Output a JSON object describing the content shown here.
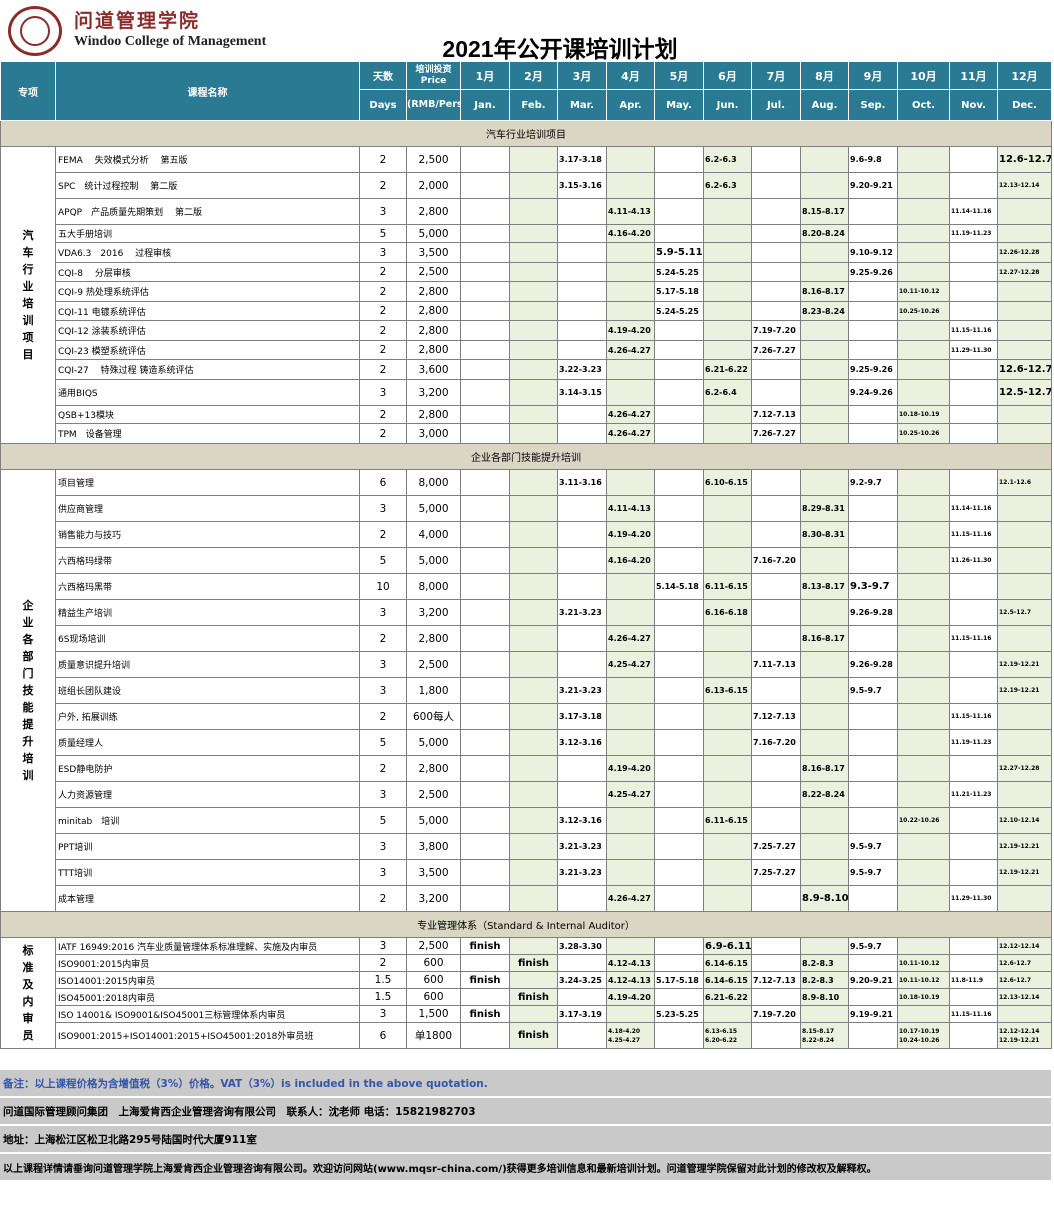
{
  "header": {
    "logo_cn": "问道管理学院",
    "logo_en": "Windoo College of Management",
    "title": "2021年公开课培训计划"
  },
  "columns": {
    "category": "专项",
    "name": "课程名称",
    "days_cn": "天数",
    "days_en": "Days",
    "price_cn": "培训投资",
    "price_en": "Price",
    "price_unit": "(RMB/Person)",
    "months_cn": [
      "1月",
      "2月",
      "3月",
      "4月",
      "5月",
      "6月",
      "7月",
      "8月",
      "9月",
      "10月",
      "11月",
      "12月"
    ],
    "months_en": [
      "Jan.",
      "Feb.",
      "Mar.",
      "Apr.",
      "May.",
      "Jun.",
      "Jul.",
      "Aug.",
      "Sep.",
      "Oct.",
      "Nov.",
      "Dec."
    ]
  },
  "sections": [
    {
      "title": "汽车行业培训项目",
      "category": "汽车行业培训项目",
      "rows": [
        {
          "name": "FEMA　 失效模式分析　 第五版",
          "days": "2",
          "price": "2,500",
          "m": [
            "",
            "",
            "3.17-3.18",
            "",
            "",
            "6.2-6.3",
            "",
            "",
            "9.6-9.8",
            "",
            "",
            "12.6-12.7"
          ]
        },
        {
          "name": "SPC　统计过程控制　 第二版",
          "days": "2",
          "price": "2,000",
          "m": [
            "",
            "",
            "3.15-3.16",
            "",
            "",
            "6.2-6.3",
            "",
            "",
            "9.20-9.21",
            "",
            "",
            "12.13-12.14"
          ]
        },
        {
          "name": "APQP　产品质量先期策划　 第二版",
          "days": "3",
          "price": "2,800",
          "m": [
            "",
            "",
            "",
            "4.11-4.13",
            "",
            "",
            "",
            "8.15-8.17",
            "",
            "",
            "11.14-11.16",
            ""
          ]
        },
        {
          "name": "五大手册培训",
          "days": "5",
          "price": "5,000",
          "m": [
            "",
            "",
            "",
            "4.16-4.20",
            "",
            "",
            "",
            "8.20-8.24",
            "",
            "",
            "11.19-11.23",
            ""
          ]
        },
        {
          "name": "VDA6.3　2016　 过程审核",
          "days": "3",
          "price": "3,500",
          "m": [
            "",
            "",
            "",
            "",
            "5.9-5.11",
            "",
            "",
            "",
            "9.10-9.12",
            "",
            "",
            "12.26-12.28"
          ]
        },
        {
          "name": "CQI-8　 分层审核",
          "days": "2",
          "price": "2,500",
          "m": [
            "",
            "",
            "",
            "",
            "5.24-5.25",
            "",
            "",
            "",
            "9.25-9.26",
            "",
            "",
            "12.27-12.28"
          ]
        },
        {
          "name": "CQI-9 热处理系统评估",
          "days": "2",
          "price": "2,800",
          "m": [
            "",
            "",
            "",
            "",
            "5.17-5.18",
            "",
            "",
            "8.16-8.17",
            "",
            "10.11-10.12",
            "",
            ""
          ]
        },
        {
          "name": "CQI-11 电镀系统评估",
          "days": "2",
          "price": "2,800",
          "m": [
            "",
            "",
            "",
            "",
            "5.24-5.25",
            "",
            "",
            "8.23-8.24",
            "",
            "10.25-10.26",
            "",
            ""
          ]
        },
        {
          "name": "CQI-12 涂装系统评估",
          "days": "2",
          "price": "2,800",
          "m": [
            "",
            "",
            "",
            "4.19-4.20",
            "",
            "",
            "7.19-7.20",
            "",
            "",
            "",
            "11.15-11.16",
            ""
          ]
        },
        {
          "name": "CQI-23 模塑系统评估",
          "days": "2",
          "price": "2,800",
          "m": [
            "",
            "",
            "",
            "4.26-4.27",
            "",
            "",
            "7.26-7.27",
            "",
            "",
            "",
            "11.29-11.30",
            ""
          ]
        },
        {
          "name": "CQI-27　 特殊过程 铸造系统评估",
          "days": "2",
          "price": "3,600",
          "m": [
            "",
            "",
            "3.22-3.23",
            "",
            "",
            "6.21-6.22",
            "",
            "",
            "9.25-9.26",
            "",
            "",
            "12.6-12.7"
          ]
        },
        {
          "name": "通用BIQS",
          "days": "3",
          "price": "3,200",
          "m": [
            "",
            "",
            "3.14-3.15",
            "",
            "",
            "6.2-6.4",
            "",
            "",
            "9.24-9.26",
            "",
            "",
            "12.5-12.7"
          ]
        },
        {
          "name": "QSB+13模块",
          "days": "2",
          "price": "2,800",
          "m": [
            "",
            "",
            "",
            "4.26-4.27",
            "",
            "",
            "7.12-7.13",
            "",
            "",
            "10.18-10.19",
            "",
            ""
          ]
        },
        {
          "name": "TPM　设备管理",
          "days": "2",
          "price": "3,000",
          "m": [
            "",
            "",
            "",
            "4.26-4.27",
            "",
            "",
            "7.26-7.27",
            "",
            "",
            "10.25-10.26",
            "",
            ""
          ]
        }
      ]
    },
    {
      "title": "企业各部门技能提升培训",
      "category": "企业各部门技能提升培训",
      "rows": [
        {
          "name": "项目管理",
          "days": "6",
          "price": "8,000",
          "m": [
            "",
            "",
            "3.11-3.16",
            "",
            "",
            "6.10-6.15",
            "",
            "",
            "9.2-9.7",
            "",
            "",
            "12.1-12.6"
          ]
        },
        {
          "name": "供应商管理",
          "days": "3",
          "price": "5,000",
          "m": [
            "",
            "",
            "",
            "4.11-4.13",
            "",
            "",
            "",
            "8.29-8.31",
            "",
            "",
            "11.14-11.16",
            ""
          ]
        },
        {
          "name": "销售能力与技巧",
          "days": "2",
          "price": "4,000",
          "m": [
            "",
            "",
            "",
            "4.19-4.20",
            "",
            "",
            "",
            "8.30-8.31",
            "",
            "",
            "11.15-11.16",
            ""
          ]
        },
        {
          "name": "六西格玛绿带",
          "days": "5",
          "price": "5,000",
          "m": [
            "",
            "",
            "",
            "4.16-4.20",
            "",
            "",
            "7.16-7.20",
            "",
            "",
            "",
            "11.26-11.30",
            ""
          ]
        },
        {
          "name": "六西格玛黑带",
          "days": "10",
          "price": "8,000",
          "m": [
            "",
            "",
            "",
            "",
            "5.14-5.18",
            "6.11-6.15",
            "",
            "8.13-8.17",
            "9.3-9.7",
            "",
            "",
            ""
          ]
        },
        {
          "name": "精益生产培训",
          "days": "3",
          "price": "3,200",
          "m": [
            "",
            "",
            "3.21-3.23",
            "",
            "",
            "6.16-6.18",
            "",
            "",
            "9.26-9.28",
            "",
            "",
            "12.5-12.7"
          ]
        },
        {
          "name": "6S现场培训",
          "days": "2",
          "price": "2,800",
          "m": [
            "",
            "",
            "",
            "4.26-4.27",
            "",
            "",
            "",
            "8.16-8.17",
            "",
            "",
            "11.15-11.16",
            ""
          ]
        },
        {
          "name": "质量意识提升培训",
          "days": "3",
          "price": "2,500",
          "m": [
            "",
            "",
            "",
            "4.25-4.27",
            "",
            "",
            "7.11-7.13",
            "",
            "9.26-9.28",
            "",
            "",
            "12.19-12.21"
          ]
        },
        {
          "name": "班组长团队建设",
          "days": "3",
          "price": "1,800",
          "m": [
            "",
            "",
            "3.21-3.23",
            "",
            "",
            "6.13-6.15",
            "",
            "",
            "9.5-9.7",
            "",
            "",
            "12.19-12.21"
          ]
        },
        {
          "name": "户外, 拓展训练",
          "days": "2",
          "price": "600每人",
          "m": [
            "",
            "",
            "3.17-3.18",
            "",
            "",
            "",
            "7.12-7.13",
            "",
            "",
            "",
            "11.15-11.16",
            ""
          ]
        },
        {
          "name": "质量经理人",
          "days": "5",
          "price": "5,000",
          "m": [
            "",
            "",
            "3.12-3.16",
            "",
            "",
            "",
            "7.16-7.20",
            "",
            "",
            "",
            "11.19-11.23",
            ""
          ]
        },
        {
          "name": "ESD静电防护",
          "days": "2",
          "price": "2,800",
          "m": [
            "",
            "",
            "",
            "4.19-4.20",
            "",
            "",
            "",
            "8.16-8.17",
            "",
            "",
            "",
            "12.27-12.28"
          ]
        },
        {
          "name": "人力资源管理",
          "days": "3",
          "price": "2,500",
          "m": [
            "",
            "",
            "",
            "4.25-4.27",
            "",
            "",
            "",
            "8.22-8.24",
            "",
            "",
            "11.21-11.23",
            ""
          ]
        },
        {
          "name": "minitab　培训",
          "days": "5",
          "price": "5,000",
          "m": [
            "",
            "",
            "3.12-3.16",
            "",
            "",
            "6.11-6.15",
            "",
            "",
            "",
            "10.22-10.26",
            "",
            "12.10-12.14"
          ]
        },
        {
          "name": "PPT培训",
          "days": "3",
          "price": "3,800",
          "m": [
            "",
            "",
            "3.21-3.23",
            "",
            "",
            "",
            "7.25-7.27",
            "",
            "9.5-9.7",
            "",
            "",
            "12.19-12.21"
          ]
        },
        {
          "name": "TTT培训",
          "days": "3",
          "price": "3,500",
          "m": [
            "",
            "",
            "3.21-3.23",
            "",
            "",
            "",
            "7.25-7.27",
            "",
            "9.5-9.7",
            "",
            "",
            "12.19-12.21"
          ]
        },
        {
          "name": "成本管理",
          "days": "2",
          "price": "3,200",
          "m": [
            "",
            "",
            "",
            "4.26-4.27",
            "",
            "",
            "",
            "8.9-8.10",
            "",
            "",
            "11.29-11.30",
            ""
          ]
        }
      ]
    },
    {
      "title": "专业管理体系（Standard & Internal Auditor）",
      "category": "标准及内审员",
      "rows": [
        {
          "name": "IATF 16949:2016 汽车业质量管理体系标准理解、实施及内审员",
          "days": "3",
          "price": "2,500",
          "m": [
            "finish",
            "",
            "3.28-3.30",
            "",
            "",
            "6.9-6.11",
            "",
            "",
            "9.5-9.7",
            "",
            "",
            "12.12-12.14"
          ]
        },
        {
          "name": "ISO9001:2015内审员",
          "days": "2",
          "price": "600",
          "m": [
            "",
            "finish",
            "",
            "4.12-4.13",
            "",
            "6.14-6.15",
            "",
            "8.2-8.3",
            "",
            "10.11-10.12",
            "",
            "12.6-12.7"
          ]
        },
        {
          "name": "ISO14001:2015内审员",
          "days": "1.5",
          "price": "600",
          "m": [
            "finish",
            "",
            "3.24-3.25",
            "4.12-4.13",
            "5.17-5.18",
            "6.14-6.15",
            "7.12-7.13",
            "8.2-8.3",
            "9.20-9.21",
            "10.11-10.12",
            "11.8-11.9",
            "12.6-12.7"
          ]
        },
        {
          "name": "ISO45001:2018内审员",
          "days": "1.5",
          "price": "600",
          "m": [
            "",
            "finish",
            "",
            "4.19-4.20",
            "",
            "6.21-6.22",
            "",
            "8.9-8.10",
            "",
            "10.18-10.19",
            "",
            "12.13-12.14"
          ]
        },
        {
          "name": "ISO 14001& ISO9001&ISO45001三标管理体系内审员",
          "days": "3",
          "price": "1,500",
          "m": [
            "finish",
            "",
            "3.17-3.19",
            "",
            "5.23-5.25",
            "",
            "7.19-7.20",
            "",
            "9.19-9.21",
            "",
            "11.15-11.16",
            ""
          ]
        },
        {
          "name": "ISO9001:2015+ISO14001:2015+ISO45001:2018外审员班",
          "days": "6",
          "price": "单1800",
          "m": [
            "",
            "finish",
            "",
            "4.18-4.20 4.25-4.27",
            "",
            "6.13-6.15 6.20-6.22",
            "",
            "8.15-8.17 8.22-8.24",
            "",
            "10.17-10.19 10.24-10.26",
            "",
            "12.12-12.14 12.19-12.21"
          ]
        }
      ]
    }
  ],
  "footer": {
    "note": "备注：以上课程价格为含增值税（3%）价格。VAT（3%）is included in the above quotation.",
    "contact": "问道国际管理顾问集团　上海爱肯西企业管理咨询有限公司　联系人：沈老师  电话：15821982703",
    "address": "地址：上海松江区松卫北路295号陆国时代大厦911室",
    "info": "以上课程详情请垂询问道管理学院上海爱肯西企业管理咨询有限公司。欢迎访问网站(www.mqsr-china.com/)获得更多培训信息和最新培训计划。问道管理学院保留对此计划的修改权及解释权。"
  },
  "colors": {
    "header_bg": "#2b7a94",
    "section_bg": "#d9d6c3",
    "shade_bg": "#ebf1de",
    "footer_bg": "#c9c9c9",
    "logo": "#8b2d2d",
    "note_text": "#3355aa"
  }
}
